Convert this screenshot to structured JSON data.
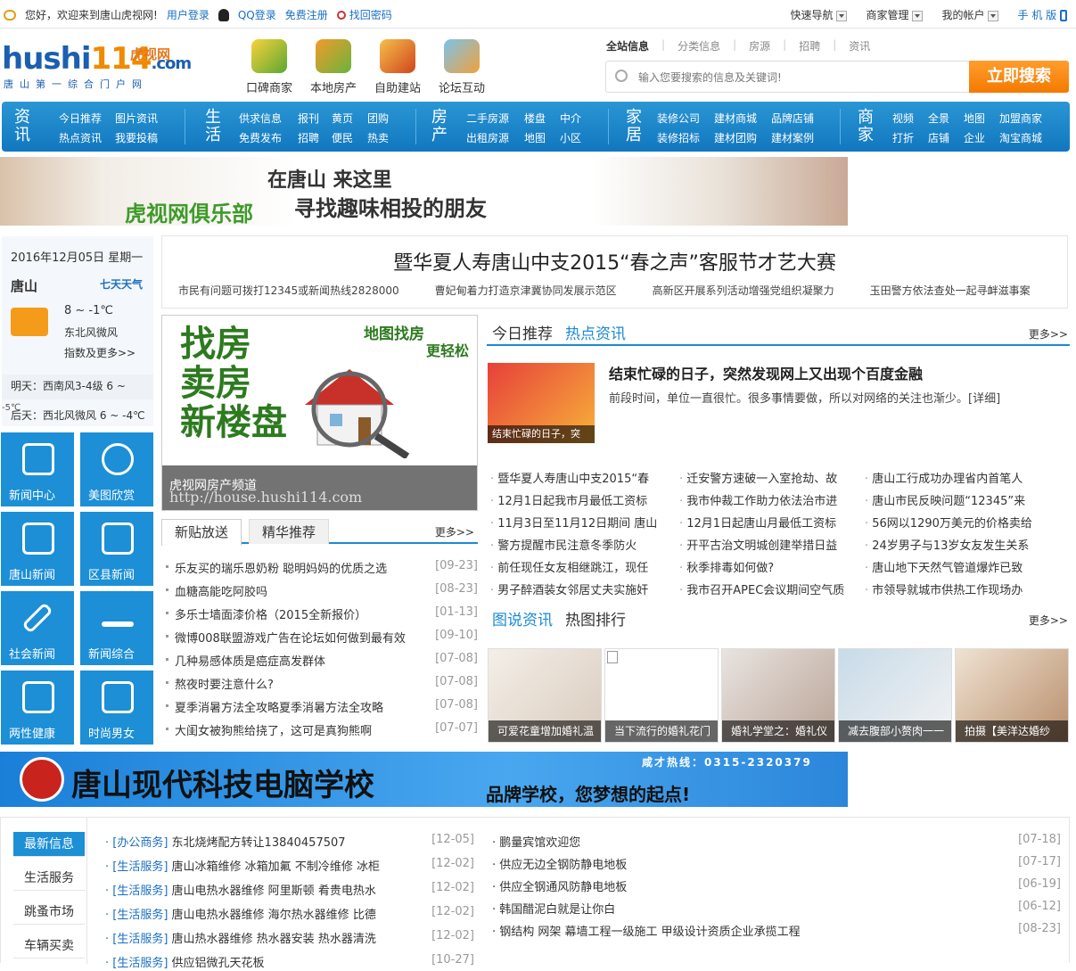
{
  "topbar": {
    "greeting": "您好，欢迎来到唐山虎视网!",
    "login": "用户登录",
    "qq_login": "QQ登录",
    "register": "免费注册",
    "forgot": "找回密码",
    "quick_nav": "快速导航",
    "merchant_mgmt": "商家管理",
    "my_account": "我的帐户",
    "mobile": "手 机 版"
  },
  "logo": {
    "text_a": "hushi",
    "text_b": "114",
    "text_c": ".com",
    "cn": "虎视网",
    "tagline": "唐山第一综合门户网"
  },
  "header_icons": [
    "口碑商家",
    "本地房产",
    "自助建站",
    "论坛互动"
  ],
  "search": {
    "tabs": [
      "全站信息",
      "分类信息",
      "房源",
      "招聘",
      "资讯"
    ],
    "placeholder": "输入您要搜索的信息及关键词!",
    "button": "立即搜索"
  },
  "nav": {
    "groups": [
      {
        "title": "资讯",
        "links": [
          "今日推荐",
          "图片资讯",
          "热点资讯",
          "我要投稿"
        ]
      },
      {
        "title": "生活",
        "links": [
          "供求信息",
          "报刊",
          "黄页",
          "团购",
          "免费发布",
          "招聘",
          "便民",
          "热卖"
        ]
      },
      {
        "title": "房产",
        "links": [
          "二手房源",
          "楼盘",
          "中介",
          "出租房源",
          "地图",
          "小区"
        ]
      },
      {
        "title": "家居",
        "links": [
          "装修公司",
          "建材商城",
          "品牌店铺",
          "装修招标",
          "建材团购",
          "建材案例"
        ]
      },
      {
        "title": "商家",
        "links": [
          "视频",
          "全景",
          "地图",
          "加盟商家",
          "打折",
          "店铺",
          "企业",
          "淘宝商城"
        ]
      }
    ]
  },
  "banner1": {
    "left": "虎视网俱乐部",
    "line1": "在唐山 来这里",
    "line2": "寻找趣味相投的朋友"
  },
  "weather": {
    "date": "2016年12月05日  星期一",
    "city": "唐山",
    "seven_day": "七天天气",
    "temp": "8 ~ -1℃",
    "wind": "东北风微风",
    "more": "指数及更多>>",
    "tomorrow": "明天：西南风3-4级  6 ~",
    "dayafter": "后天：西北风微风  6 ~ -4℃",
    "dayafter_low": "-5℃"
  },
  "tiles": [
    "新闻中心",
    "美图欣赏",
    "唐山新闻",
    "区县新闻",
    "社会新闻",
    "新闻综合",
    "两性健康",
    "时尚男女"
  ],
  "headline": {
    "title": "暨华夏人寿唐山中支2015“春之声”客服节才艺大赛",
    "subs": [
      "市民有问题可拨打12345或新闻热线2828000",
      "曹妃甸着力打造京津冀协同发展示范区",
      "高新区开展系列活动增强党组织凝聚力",
      "玉田警方依法查处一起寻衅滋事案"
    ]
  },
  "housebox": {
    "big": "找房 卖房 新楼盘",
    "top": "地图找房",
    "top2": "更轻松",
    "caption": "虎视网房产频道",
    "url": "http://house.hushi114.com"
  },
  "posts": {
    "tab_new": "新贴放送",
    "tab_best": "精华推荐",
    "more": "更多>>",
    "items": [
      {
        "t": "乐友买的瑞乐恩奶粉 聪明妈妈的优质之选",
        "d": "[09-23]"
      },
      {
        "t": "血糖高能吃阿胶吗",
        "d": "[08-23]"
      },
      {
        "t": "多乐士墙面漆价格（2015全新报价）",
        "d": "[01-13]"
      },
      {
        "t": "微博008联盟游戏广告在论坛如何做到最有效",
        "d": "[09-10]"
      },
      {
        "t": "几种易感体质是癌症高发群体",
        "d": "[07-08]"
      },
      {
        "t": "熬夜时要注意什么?",
        "d": "[07-08]"
      },
      {
        "t": "夏季消暑方法全攻略夏季消暑方法全攻略",
        "d": "[07-08]"
      },
      {
        "t": "大闺女被狗熊给挠了，这可是真狗熊啊",
        "d": "[07-07]"
      }
    ]
  },
  "right": {
    "tab_today": "今日推荐",
    "tab_hot": "热点资讯",
    "more": "更多>>",
    "feat_caption": "结束忙碌的日子，突",
    "feat_title": "结束忙碌的日子，突然发现网上又出现个百度金融",
    "feat_desc": "前段时间，单位一直很忙。很多事情要做，所以对网络的关注也渐少。[详细]",
    "grid": [
      [
        "暨华夏人寿唐山中支2015“春",
        "迁安警方速破一入室抢劫、故",
        "唐山工行成功办理省内首笔人"
      ],
      [
        "12月1日起我市月最低工资标",
        "我市仲裁工作助力依法治市进",
        "唐山市民反映问题“12345”来"
      ],
      [
        "11月3日至11月12日期间 唐山",
        "12月1日起唐山月最低工资标",
        "56网以1290万美元的价格卖给"
      ],
      [
        "警方提醒市民注意冬季防火",
        "开平古治文明城创建举措日益",
        "24岁男子与13岁女友发生关系"
      ],
      [
        "前任现任女友相继跳江，现任",
        "秋季排毒如何做?",
        "唐山地下天然气管道爆炸已致"
      ],
      [
        "男子醉酒装女邻居丈夫实施奸",
        "我市召开APEC会议期间空气质",
        "市领导就城市供热工作现场办"
      ]
    ],
    "pic_tab1": "图说资讯",
    "pic_tab2": "热图排行",
    "pics": [
      "可爱花童增加婚礼温",
      "当下流行的婚礼花门",
      "婚礼学堂之：婚礼仪",
      "减去腹部小赘肉一一",
      "拍摄【美洋达婚纱"
    ]
  },
  "banner2": {
    "title": "唐山现代科技电脑学校",
    "slogan": "品牌学校，您梦想的起点!",
    "phone": "咸才热线：0315-2320379"
  },
  "classifieds": {
    "tabs": [
      "最新信息",
      "生活服务",
      "跳蚤市场",
      "车辆买卖"
    ],
    "left": [
      {
        "cat": "[办公商务]",
        "t": "东北烧烤配方转让13840457507",
        "d": "[12-05]"
      },
      {
        "cat": "[生活服务]",
        "t": "唐山冰箱维修 冰箱加氟 不制冷维修 冰柜",
        "d": "[12-02]"
      },
      {
        "cat": "[生活服务]",
        "t": "唐山电热水器维修 阿里斯顿 肴贵电热水",
        "d": "[12-02]"
      },
      {
        "cat": "[生活服务]",
        "t": "唐山电热水器维修 海尔热水器维修 比德",
        "d": "[12-02]"
      },
      {
        "cat": "[生活服务]",
        "t": "唐山热水器维修 热水器安装 热水器清洗",
        "d": "[12-02]"
      },
      {
        "cat": "[生活服务]",
        "t": "供应铝微孔天花板",
        "d": "[10-27]"
      }
    ],
    "right": [
      {
        "t": "鹏量宾馆欢迎您",
        "d": "[07-18]"
      },
      {
        "t": "供应无边全钢防静电地板",
        "d": "[07-17]"
      },
      {
        "t": "供应全钢通风防静电地板",
        "d": "[06-19]"
      },
      {
        "t": "韩国醋泥白就是让你白",
        "d": "[06-12]"
      },
      {
        "t": "钢结构 网架 幕墙工程一级施工 甲级设计资质企业承揽工程",
        "d": "[08-23]"
      }
    ]
  },
  "colors": {
    "brand_blue": "#1c8fd6",
    "accent_orange": "#f47a00"
  }
}
